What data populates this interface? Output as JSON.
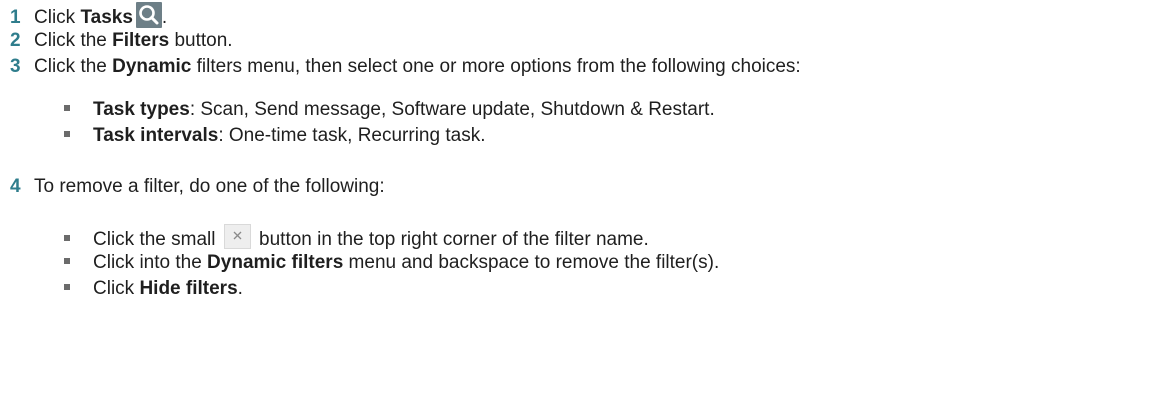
{
  "steps": [
    {
      "number": "1",
      "t1": "Click ",
      "b1": "Tasks",
      "t2": "."
    },
    {
      "number": "2",
      "t1": "Click the ",
      "b1": "Filters",
      "t2": " button."
    },
    {
      "number": "3",
      "t1": "Click the ",
      "b1": "Dynamic",
      "t2": " filters menu, then select one or more options from the following choices:",
      "bullets": [
        {
          "b": "Task types",
          "t": ": Scan, Send message, Software update, Shutdown & Restart."
        },
        {
          "b": "Task intervals",
          "t": ": One-time task, Recurring task."
        }
      ]
    },
    {
      "number": "4",
      "t1": "To remove a filter, do one of the following:",
      "bullets": [
        {
          "t1": "Click the small ",
          "t2": " button in the top right corner of the filter name."
        },
        {
          "t1": "Click into the ",
          "b": "Dynamic filters",
          "t2": " menu and backspace to remove the filter(s)."
        },
        {
          "t1": "Click ",
          "b": "Hide filters",
          "t2": "."
        }
      ]
    }
  ],
  "icons": {
    "tasks_icon": "search-icon",
    "close_icon": "close-icon"
  },
  "colors": {
    "step_number": "#2f7d8c",
    "bullet": "#6b6b6b",
    "tasks_icon_bg": "#6d7f87",
    "close_icon_bg": "#eeeeee"
  }
}
